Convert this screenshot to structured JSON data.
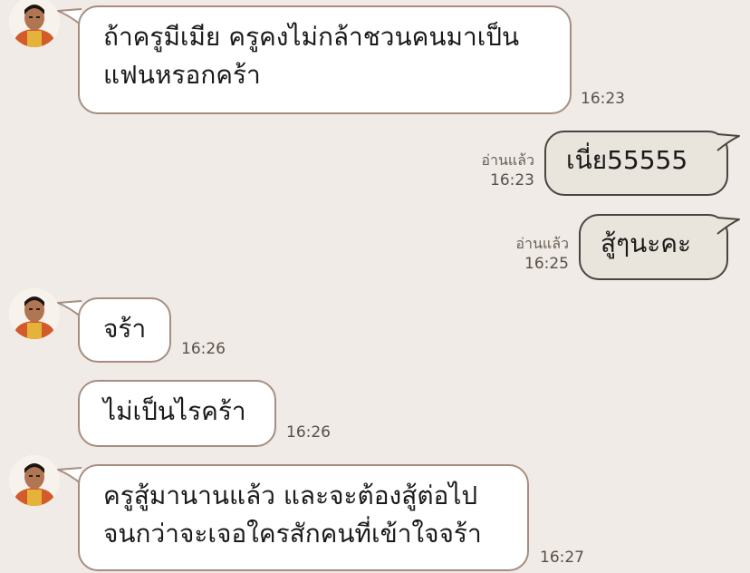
{
  "colors": {
    "background": "#f0ebe6",
    "incoming_bubble": "#ffffff",
    "incoming_border": "#a58e80",
    "outgoing_bubble": "#e9e4dc",
    "outgoing_border": "#4a4440",
    "timestamp": "#5a4f48"
  },
  "messages": [
    {
      "direction": "incoming",
      "text": "ถ้าครูมีเมีย ครูคงไม่กล้าชวนคนมาเป็น\nแฟนหรอกคร้า",
      "time": "16:23",
      "avatar_icon": "contact-avatar-icon"
    },
    {
      "direction": "outgoing",
      "text": "เนี่ย55555",
      "read": "อ่านแล้ว",
      "time": "16:23"
    },
    {
      "direction": "outgoing",
      "text": "สู้ๆนะคะ",
      "read": "อ่านแล้ว",
      "time": "16:25"
    },
    {
      "direction": "incoming",
      "text": "จร้า",
      "time": "16:26",
      "avatar_icon": "contact-avatar-icon"
    },
    {
      "direction": "incoming",
      "text": "ไม่เป็นไรคร้า",
      "time": "16:26"
    },
    {
      "direction": "incoming",
      "text": "ครูสู้มานานแล้ว และจะต้องสู้ต่อไป\nจนกว่าจะเจอใครสักคนที่เข้าใจจร้า",
      "time": "16:27",
      "avatar_icon": "contact-avatar-icon"
    }
  ]
}
